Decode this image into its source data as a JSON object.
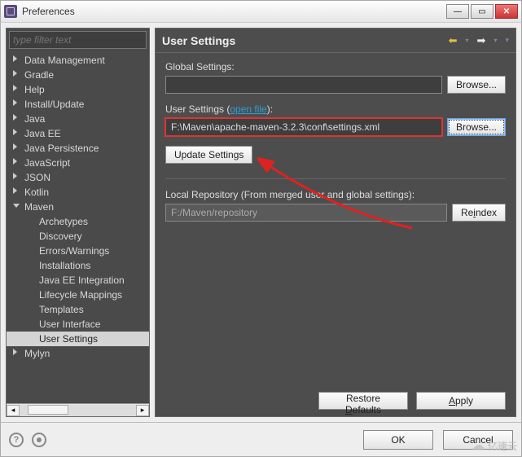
{
  "window": {
    "title": "Preferences"
  },
  "filter": {
    "placeholder": "type filter text"
  },
  "tree": {
    "items": [
      {
        "label": "Data Management",
        "state": "collapsed"
      },
      {
        "label": "Gradle",
        "state": "collapsed"
      },
      {
        "label": "Help",
        "state": "collapsed"
      },
      {
        "label": "Install/Update",
        "state": "collapsed"
      },
      {
        "label": "Java",
        "state": "collapsed"
      },
      {
        "label": "Java EE",
        "state": "collapsed"
      },
      {
        "label": "Java Persistence",
        "state": "collapsed"
      },
      {
        "label": "JavaScript",
        "state": "collapsed"
      },
      {
        "label": "JSON",
        "state": "collapsed"
      },
      {
        "label": "Kotlin",
        "state": "collapsed"
      },
      {
        "label": "Maven",
        "state": "expanded",
        "children": [
          {
            "label": "Archetypes"
          },
          {
            "label": "Discovery"
          },
          {
            "label": "Errors/Warnings"
          },
          {
            "label": "Installations"
          },
          {
            "label": "Java EE Integration"
          },
          {
            "label": "Lifecycle Mappings"
          },
          {
            "label": "Templates"
          },
          {
            "label": "User Interface"
          },
          {
            "label": "User Settings",
            "selected": true
          }
        ]
      },
      {
        "label": "Mylyn",
        "state": "collapsed"
      }
    ]
  },
  "page": {
    "title": "User Settings",
    "globalSettingsLabel": "Global Settings:",
    "globalSettingsValue": "",
    "browse": "Browse...",
    "userSettingsPrefix": "User Settings (",
    "userSettingsLink": "open file",
    "userSettingsSuffix": "):",
    "userSettingsValue": "F:\\Maven\\apache-maven-3.2.3\\conf\\settings.xml",
    "updateSettings": "Update Settings",
    "localRepoLabel": "Local Repository (From merged user and global settings):",
    "localRepoValue": "F:/Maven/repository",
    "reindexPrefix": "Re",
    "reindexUnderline": "i",
    "reindexSuffix": "ndex",
    "restoreDefaultsPrefix": "Restore ",
    "restoreDefaultsUnderline": "D",
    "restoreDefaultsSuffix": "efaults",
    "applyUnderline": "A",
    "applySuffix": "pply"
  },
  "buttons": {
    "ok": "OK",
    "cancel": "Cancel"
  },
  "watermark": "亿速云"
}
